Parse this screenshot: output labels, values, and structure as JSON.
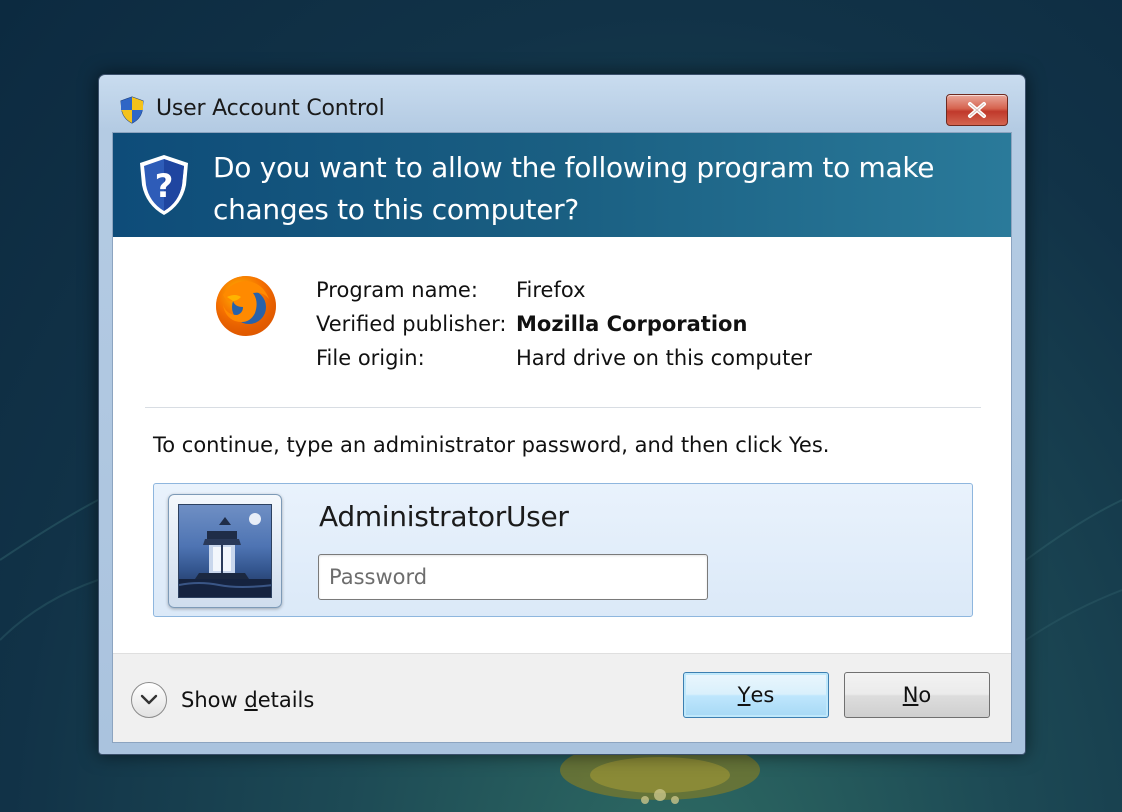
{
  "window": {
    "title": "User Account Control",
    "close_label": "×"
  },
  "banner": {
    "question": "Do you want to allow the following program to make changes to this computer?"
  },
  "program": {
    "name_label": "Program name:",
    "name_value": "Firefox",
    "publisher_label": "Verified publisher:",
    "publisher_value": "Mozilla Corporation",
    "origin_label": "File origin:",
    "origin_value": "Hard drive on this computer"
  },
  "credentials": {
    "instruction": "To continue, type an administrator password, and then click Yes.",
    "username": "AdministratorUser",
    "password_placeholder": "Password",
    "password_value": ""
  },
  "footer": {
    "show_details_pre": "Show ",
    "show_details_access": "d",
    "show_details_post": "etails",
    "yes_access": "Y",
    "yes_rest": "es",
    "no_access": "N",
    "no_rest": "o"
  },
  "colors": {
    "banner": "#1a5f82",
    "close_button": "#c0392b",
    "credential_panel": "#dbe9f8",
    "default_button_border": "#3c7fb1"
  },
  "icons": {
    "title": "uac-shield-icon",
    "banner": "question-shield-icon",
    "program": "firefox-logo",
    "user": "lighthouse-user-picture",
    "details": "chevron-down-icon"
  }
}
